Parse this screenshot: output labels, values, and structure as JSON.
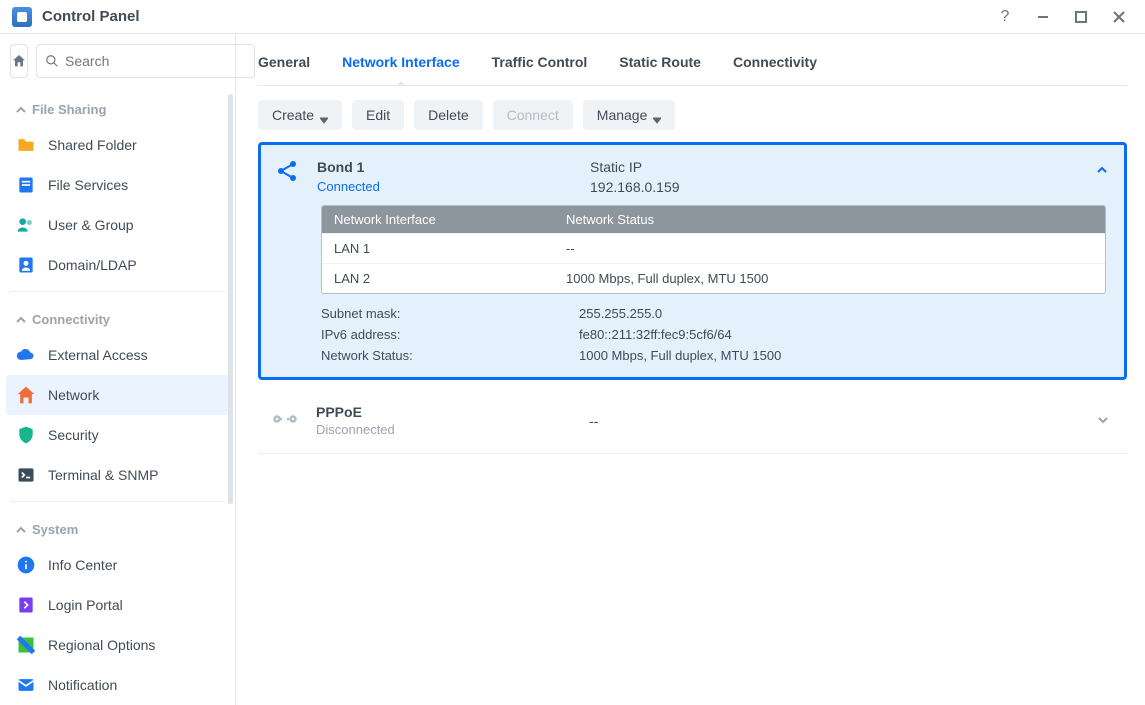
{
  "window": {
    "title": "Control Panel"
  },
  "search": {
    "placeholder": "Search"
  },
  "sidebar": {
    "sections": [
      {
        "label": "File Sharing",
        "items": [
          {
            "id": "shared-folder",
            "label": "Shared Folder",
            "color": "#f6a823"
          },
          {
            "id": "file-services",
            "label": "File Services",
            "color": "#1f78f0"
          },
          {
            "id": "user-group",
            "label": "User & Group",
            "color": "#1aa6a0"
          },
          {
            "id": "domain-ldap",
            "label": "Domain/LDAP",
            "color": "#1f78f0"
          }
        ]
      },
      {
        "label": "Connectivity",
        "items": [
          {
            "id": "external-access",
            "label": "External Access",
            "color": "#1f78f0"
          },
          {
            "id": "network",
            "label": "Network",
            "color": "#f06c3a",
            "active": true
          },
          {
            "id": "security",
            "label": "Security",
            "color": "#16b58a"
          },
          {
            "id": "terminal-snmp",
            "label": "Terminal & SNMP",
            "color": "#3a4b5c"
          }
        ]
      },
      {
        "label": "System",
        "items": [
          {
            "id": "info-center",
            "label": "Info Center",
            "color": "#1f78f0"
          },
          {
            "id": "login-portal",
            "label": "Login Portal",
            "color": "#7a3cf0"
          },
          {
            "id": "regional-options",
            "label": "Regional Options",
            "color": "#3cbf3c"
          },
          {
            "id": "notification",
            "label": "Notification",
            "color": "#1f78f0"
          }
        ]
      }
    ]
  },
  "tabs": {
    "items": [
      {
        "id": "general",
        "label": "General"
      },
      {
        "id": "network-interface",
        "label": "Network Interface",
        "active": true
      },
      {
        "id": "traffic-control",
        "label": "Traffic Control"
      },
      {
        "id": "static-route",
        "label": "Static Route"
      },
      {
        "id": "connectivity",
        "label": "Connectivity"
      }
    ]
  },
  "toolbar": {
    "create": "Create",
    "edit": "Edit",
    "delete": "Delete",
    "connect": "Connect",
    "manage": "Manage"
  },
  "bond": {
    "name": "Bond 1",
    "status": "Connected",
    "ip_type": "Static IP",
    "ip": "192.168.0.159",
    "table_headers": {
      "iface": "Network Interface",
      "status": "Network Status"
    },
    "rows": [
      {
        "iface": "LAN 1",
        "status": "--"
      },
      {
        "iface": "LAN 2",
        "status": "1000 Mbps, Full duplex, MTU 1500"
      }
    ],
    "details": {
      "subnet_label": "Subnet mask:",
      "subnet_value": "255.255.255.0",
      "ipv6_label": "IPv6 address:",
      "ipv6_value": "fe80::211:32ff:fec9:5cf6/64",
      "netstat_label": "Network Status:",
      "netstat_value": "1000 Mbps, Full duplex, MTU 1500"
    }
  },
  "pppoe": {
    "name": "PPPoE",
    "status": "Disconnected",
    "value": "--"
  }
}
